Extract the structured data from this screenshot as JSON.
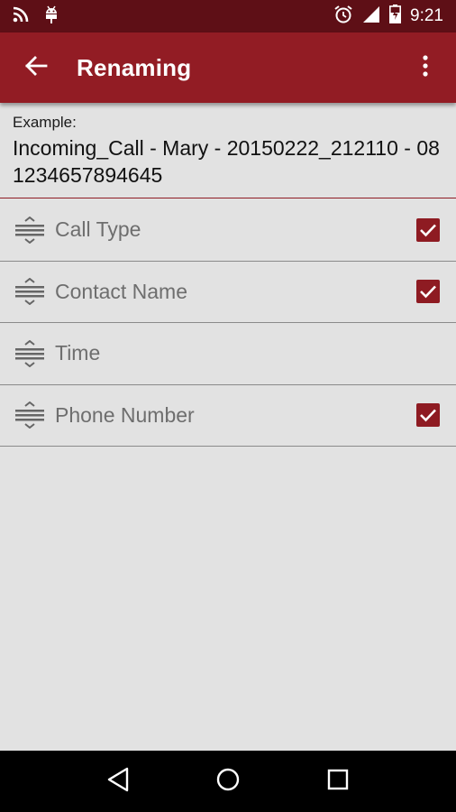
{
  "status_bar": {
    "time": "9:21",
    "left_icons": [
      "rss-icon",
      "android-debug-icon"
    ],
    "right_icons": [
      "alarm-icon",
      "signal-icon",
      "battery-charging-icon"
    ]
  },
  "app_bar": {
    "title": "Renaming",
    "back_icon": "arrow-back-icon",
    "menu_icon": "more-vert-icon"
  },
  "example": {
    "label": "Example:",
    "text": "Incoming_Call - Mary - 20150222_212110 - 081234657894645"
  },
  "fields": [
    {
      "label": "Call Type",
      "checked": true
    },
    {
      "label": "Contact Name",
      "checked": true
    },
    {
      "label": "Time",
      "checked": false
    },
    {
      "label": "Phone Number",
      "checked": true
    }
  ],
  "nav_bar": {
    "icons": [
      "back-triangle-icon",
      "home-circle-icon",
      "recents-square-icon"
    ]
  },
  "colors": {
    "status_bar": "#5e0f16",
    "app_bar": "#921c24",
    "accent": "#8e1b22",
    "background": "#e2e2e2"
  }
}
